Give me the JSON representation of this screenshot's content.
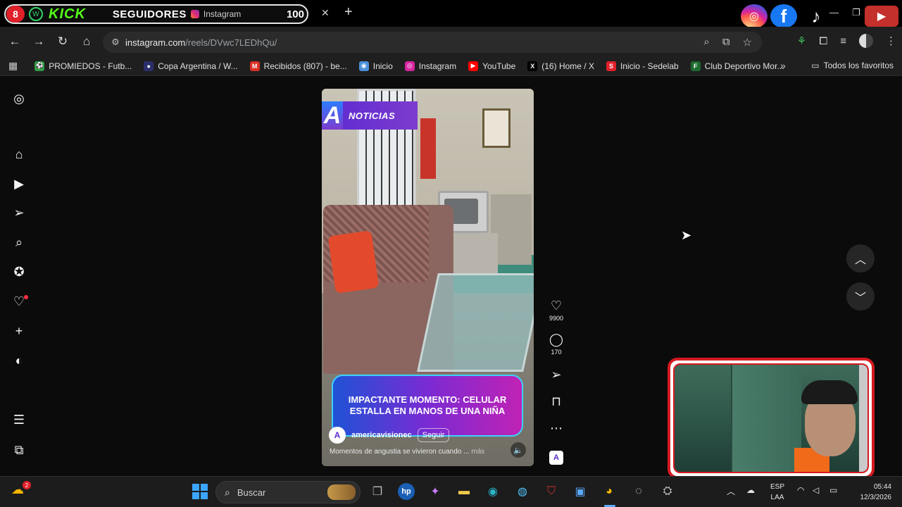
{
  "browser": {
    "stream_banner": {
      "badge": "8",
      "wa_label": "W",
      "kick": "KICK",
      "seguidores": "SEGUIDORES",
      "count": "100"
    },
    "active_tab": {
      "title": "Instagram",
      "close": "✕"
    },
    "new_tab": "+",
    "window_controls": {
      "minimize": "—",
      "restore": "❐",
      "close": "✕"
    },
    "url": {
      "host": "instagram.com",
      "path": "/reels/DVwc7LEDhQu/"
    },
    "bookmarks": [
      {
        "label": "PROMIEDOS - Futb...",
        "icon": "soccer-icon",
        "color": "#2f9e44",
        "glyph": "⚽"
      },
      {
        "label": "Copa Argentina / W...",
        "icon": "cup-icon",
        "color": "#2a2f6b",
        "glyph": "●"
      },
      {
        "label": "Recibidos (807) - be...",
        "icon": "gmail-icon",
        "color": "#d93025",
        "glyph": "M"
      },
      {
        "label": "Inicio",
        "icon": "home-site-icon",
        "color": "#4a90d9",
        "glyph": "◉"
      },
      {
        "label": "Instagram",
        "icon": "instagram-icon",
        "color": "#d6249f",
        "glyph": "◎"
      },
      {
        "label": "YouTube",
        "icon": "youtube-icon",
        "color": "#ff0000",
        "glyph": "▶"
      },
      {
        "label": "(16) Home / X",
        "icon": "x-icon",
        "color": "#000000",
        "glyph": "X"
      },
      {
        "label": "Inicio - Sedelab",
        "icon": "sedelab-icon",
        "color": "#e0202a",
        "glyph": "S"
      },
      {
        "label": "Club Deportivo Mor...",
        "icon": "club-icon",
        "color": "#1c6b2f",
        "glyph": "F"
      }
    ],
    "all_bookmarks": "Todos los favoritos"
  },
  "reel": {
    "brand": {
      "letter": "A",
      "text": "NOTICIAS"
    },
    "headline": "IMPACTANTE MOMENTO: CELULAR ESTALLA EN MANOS DE UNA NIÑA",
    "author": "americavisionec",
    "follow": "Seguir",
    "caption": "Momentos de angustia se vivieron cuando ...",
    "caption_more": "más",
    "likes": "9900",
    "comments": "170"
  },
  "taskbar": {
    "weather_badge": "2",
    "search_placeholder": "Buscar",
    "lang_top": "ESP",
    "lang_bottom": "LAA",
    "time": "05:44",
    "date": "12/3/2026"
  },
  "colors": {
    "accent_kick": "#53fc18",
    "webcam_frame": "#d71920",
    "headline_border": "#3fd0ff"
  }
}
